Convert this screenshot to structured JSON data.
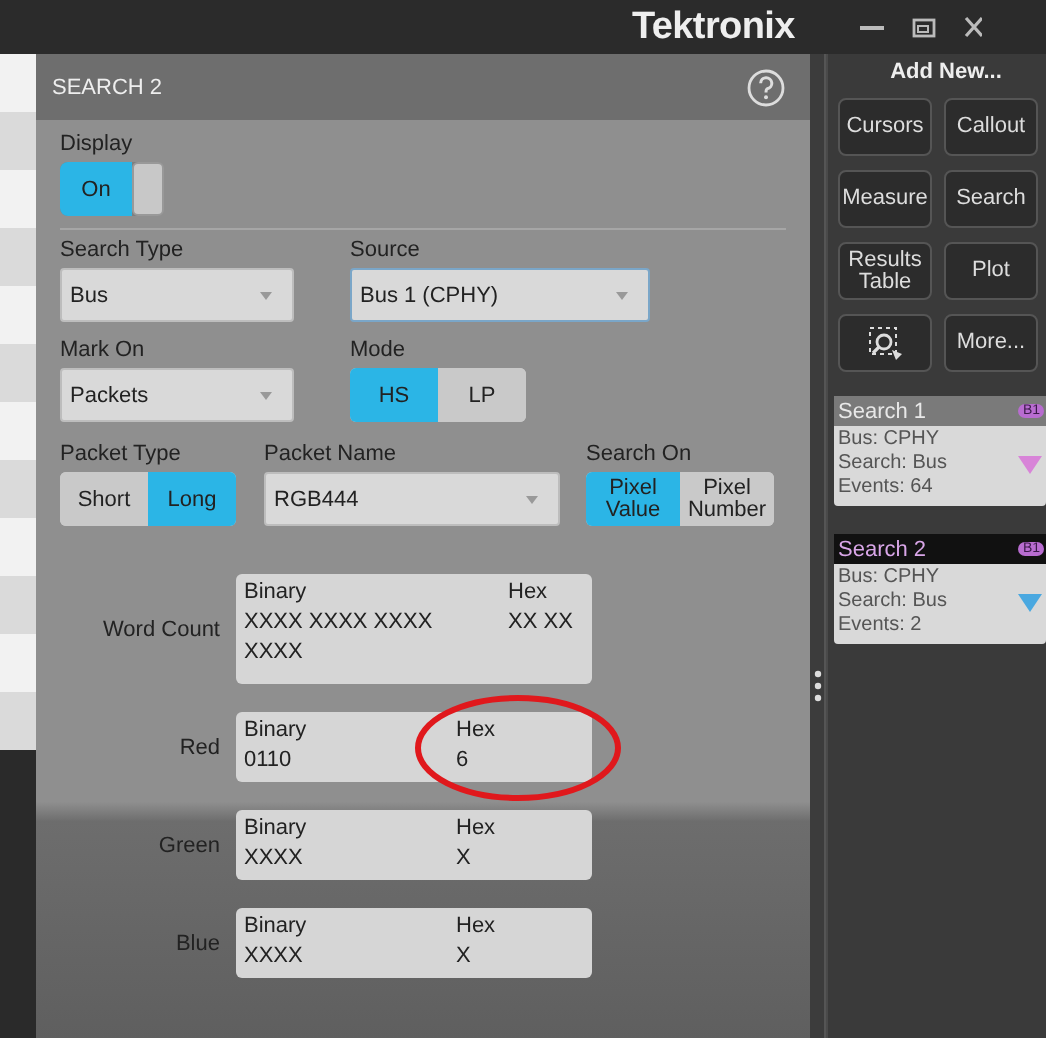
{
  "app_bar": {
    "logo": "Tektronix"
  },
  "dialog": {
    "title": "SEARCH 2",
    "display": {
      "label": "Display",
      "value": "On",
      "on": true
    },
    "search_type": {
      "label": "Search Type",
      "value": "Bus"
    },
    "source": {
      "label": "Source",
      "value": "Bus 1 (CPHY)"
    },
    "mark_on": {
      "label": "Mark On",
      "value": "Packets"
    },
    "mode": {
      "label": "Mode",
      "options": [
        {
          "label": "HS",
          "selected": true
        },
        {
          "label": "LP",
          "selected": false
        }
      ]
    },
    "packet_type": {
      "label": "Packet Type",
      "options": [
        {
          "label": "Short",
          "selected": false
        },
        {
          "label": "Long",
          "selected": true
        }
      ]
    },
    "packet_name": {
      "label": "Packet Name",
      "value": "RGB444"
    },
    "search_on": {
      "label": "Search On",
      "options": [
        {
          "label": "Pixel Value",
          "selected": true
        },
        {
          "label": "Pixel Number",
          "selected": false
        }
      ]
    },
    "fields": [
      {
        "label": "Word Count",
        "binary_label": "Binary",
        "binary": "XXXX XXXX XXXX XXXX",
        "hex_label": "Hex",
        "hex": "XX XX",
        "circled": false
      },
      {
        "label": "Red",
        "binary_label": "Binary",
        "binary": "0110",
        "hex_label": "Hex",
        "hex": "6",
        "circled": true
      },
      {
        "label": "Green",
        "binary_label": "Binary",
        "binary": "XXXX",
        "hex_label": "Hex",
        "hex": "X",
        "circled": false
      },
      {
        "label": "Blue",
        "binary_label": "Binary",
        "binary": "XXXX",
        "hex_label": "Hex",
        "hex": "X",
        "circled": false
      }
    ]
  },
  "add_new": {
    "title": "Add New...",
    "buttons": [
      {
        "kind": "text",
        "label": "Cursors"
      },
      {
        "kind": "text",
        "label": "Callout"
      },
      {
        "kind": "text",
        "label": "Measure"
      },
      {
        "kind": "text",
        "label": "Search"
      },
      {
        "kind": "text",
        "label": "Results Table"
      },
      {
        "kind": "text",
        "label": "Plot"
      },
      {
        "kind": "zoom"
      },
      {
        "kind": "text",
        "label": "More..."
      }
    ]
  },
  "searches": [
    {
      "title": "Search 1",
      "badge": "B1",
      "lines": [
        "Bus: CPHY",
        "Search: Bus",
        "Events: 64"
      ],
      "color": "#d884d8",
      "selected": false
    },
    {
      "title": "Search 2",
      "badge": "B1",
      "lines": [
        "Bus: CPHY",
        "Search: Bus",
        "Events: 2"
      ],
      "color": "#4aa8e0",
      "selected": true
    }
  ]
}
